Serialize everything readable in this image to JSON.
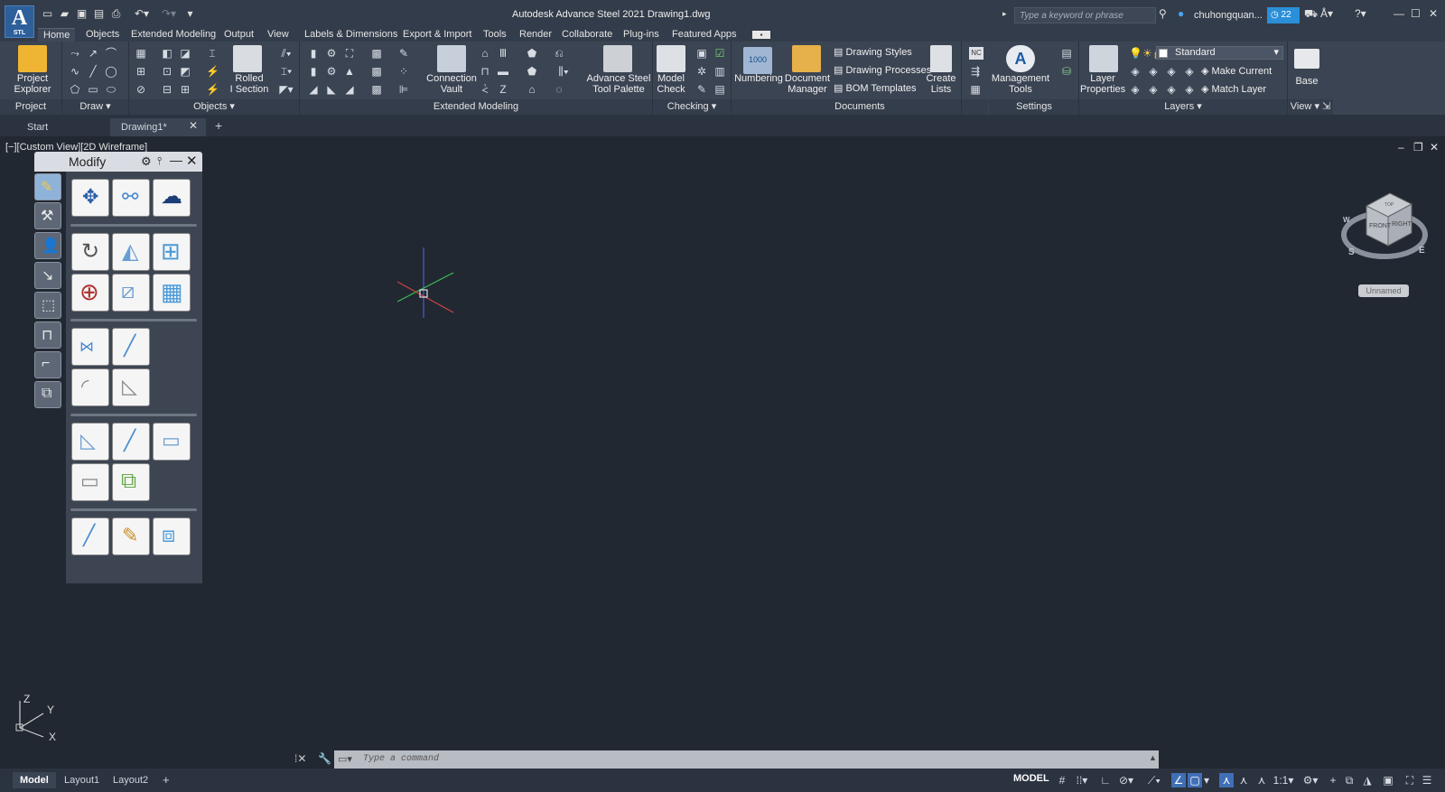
{
  "app": {
    "logo_letter": "A",
    "logo_sub": "STL",
    "title": "Autodesk Advance Steel 2021    Drawing1.dwg",
    "search_placeholder": "Type a keyword or phrase",
    "user": "chuhongquan...",
    "timer_count": "22"
  },
  "menu": [
    "Home",
    "Objects",
    "Extended Modeling",
    "Output",
    "View",
    "Labels & Dimensions",
    "Export & Import",
    "Tools",
    "Render",
    "Collaborate",
    "Plug-ins",
    "Featured Apps"
  ],
  "ribbon": {
    "project_explorer": "Project\nExplorer",
    "project_explorer_l1": "Project",
    "project_explorer_l2": "Explorer",
    "rolled_l1": "Rolled",
    "rolled_l2": "I Section",
    "connection_vault_l1": "Connection",
    "connection_vault_l2": "Vault",
    "advance_palette_l1": "Advance Steel",
    "advance_palette_l2": "Tool Palette",
    "model_check_l1": "Model",
    "model_check_l2": "Check",
    "numbering": "Numbering",
    "numbering_badge": "1000",
    "doc_manager_l1": "Document",
    "doc_manager_l2": "Manager",
    "drawing_styles": "Drawing Styles",
    "drawing_processes": "Drawing Processes",
    "bom_templates": "BOM Templates",
    "create_lists_l1": "Create",
    "create_lists_l2": "Lists",
    "nc_badge": "NC",
    "mgmt_tools_l1": "Management",
    "mgmt_tools_l2": "Tools",
    "layer_props_l1": "Layer",
    "layer_props_l2": "Properties",
    "layer_current": "Standard",
    "make_current": "Make Current",
    "match_layer": "Match Layer",
    "base": "Base"
  },
  "panels": {
    "project": "Project",
    "draw": "Draw",
    "objects": "Objects",
    "extended_modeling": "Extended Modeling",
    "checking": "Checking",
    "documents": "Documents",
    "settings": "Settings",
    "layers": "Layers",
    "view": "View"
  },
  "file_tabs": [
    "Start",
    "Drawing1*"
  ],
  "viewport": {
    "label": "[−][Custom View][2D Wireframe]",
    "viewcube_front": "FRONT",
    "viewcube_right": "RIGHT",
    "viewcube_top": "TOP",
    "compass_s": "S",
    "compass_e": "E",
    "compass_w": "W",
    "named_view": "Unnamed"
  },
  "modify_palette": {
    "title": "Modify"
  },
  "ucs": {
    "z": "Z",
    "y": "Y",
    "x": "X"
  },
  "command": {
    "placeholder": "Type a command"
  },
  "layout_tabs": [
    "Model",
    "Layout1",
    "Layout2"
  ],
  "status": {
    "model": "MODEL",
    "scale": "1:1"
  },
  "colors": {
    "accent": "#2a8fd8",
    "background": "#212832",
    "ribbon": "#3b4453"
  }
}
